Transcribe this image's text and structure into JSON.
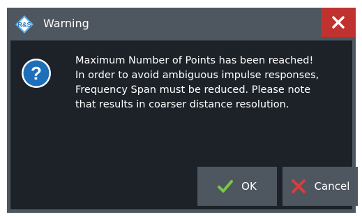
{
  "window": {
    "title": "Warning",
    "close_icon": "close-icon",
    "logo_icon": "rohde-schwarz-logo",
    "colors": {
      "frame": "#4e5660",
      "body": "#1d2229",
      "close": "#c0322f",
      "icon_blue": "#1c6fb8",
      "ok_check": "#7ac943",
      "cancel_x": "#e03a3a"
    }
  },
  "message": {
    "icon": "question-icon",
    "lines": [
      "Maximum Number of Points has been reached!",
      "In order to avoid ambiguous impulse responses,",
      "Frequency Span must be reduced. Please note",
      "that results in coarser distance resolution."
    ]
  },
  "buttons": {
    "ok_label": "OK",
    "cancel_label": "Cancel"
  }
}
